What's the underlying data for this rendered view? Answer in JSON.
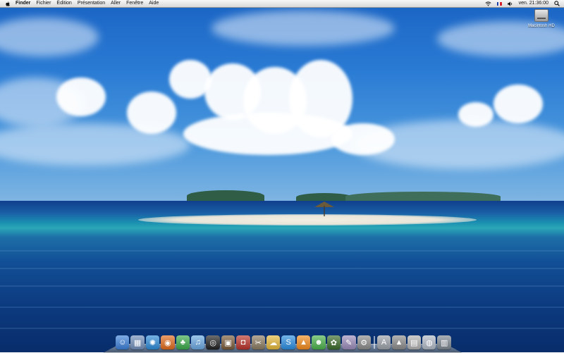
{
  "menubar": {
    "app_name": "Finder",
    "items": [
      "Fichier",
      "Édition",
      "Présentation",
      "Aller",
      "Fenêtre",
      "Aide"
    ],
    "clock": "ven. 21:36:00",
    "icons": [
      "apple-icon",
      "wifi-icon",
      "flag-icon",
      "volume-icon",
      "spotlight-icon"
    ]
  },
  "desktop": {
    "hard_drive_label": "Macintosh HD"
  },
  "dock": {
    "apps": [
      {
        "icon": "finder-icon",
        "color": "#3b7fd8",
        "glyph": "☺"
      },
      {
        "icon": "preview-icon",
        "color": "#6f8db8",
        "glyph": "▦"
      },
      {
        "icon": "safari-icon",
        "color": "#2d8ad6",
        "glyph": "✺"
      },
      {
        "icon": "firefox-icon",
        "color": "#e06a1c",
        "glyph": "◉"
      },
      {
        "icon": "growl-icon",
        "color": "#3aa84a",
        "glyph": "♣"
      },
      {
        "icon": "itunes-icon",
        "color": "#6aa7e0",
        "glyph": "♫"
      },
      {
        "icon": "dvd-player-icon",
        "color": "#202020",
        "glyph": "◎"
      },
      {
        "icon": "iphoto-icon",
        "color": "#7a5a3a",
        "glyph": "▣"
      },
      {
        "icon": "photo-booth-icon",
        "color": "#b8322a",
        "glyph": "◘"
      },
      {
        "icon": "tools-icon",
        "color": "#8a7a60",
        "glyph": "✂"
      },
      {
        "icon": "cyberduck-icon",
        "color": "#e2b63a",
        "glyph": "☁"
      },
      {
        "icon": "skype-icon",
        "color": "#2a8ce0",
        "glyph": "S"
      },
      {
        "icon": "vlc-icon",
        "color": "#f08a1c",
        "glyph": "▲"
      },
      {
        "icon": "messenger-icon",
        "color": "#4ab04a",
        "glyph": "☻"
      },
      {
        "icon": "adium-icon",
        "color": "#3a6a2a",
        "glyph": "✿"
      },
      {
        "icon": "script-editor-icon",
        "color": "#9a8ab8",
        "glyph": "✎"
      },
      {
        "icon": "system-preferences-icon",
        "color": "#8a8a8a",
        "glyph": "⚙"
      }
    ],
    "others": [
      {
        "icon": "applications-folder-icon",
        "color": "#9aa0a8",
        "glyph": "A"
      },
      {
        "icon": "documents-stack-icon",
        "color": "#8a8a8a",
        "glyph": "▲"
      },
      {
        "icon": "downloads-stack-icon",
        "color": "#b0b0b0",
        "glyph": "▤"
      },
      {
        "icon": "network-icon",
        "color": "#b0b8c4",
        "glyph": "◍"
      },
      {
        "icon": "trash-icon",
        "color": "#7c8690",
        "glyph": "▥"
      }
    ]
  }
}
